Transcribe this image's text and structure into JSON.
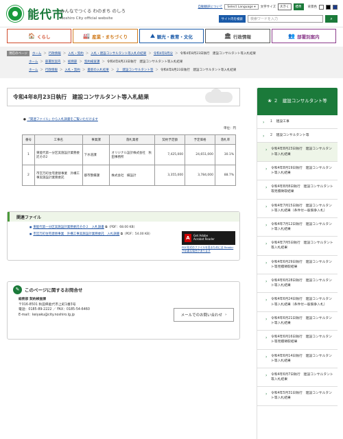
{
  "header": {
    "site_name": "能代市",
    "tagline": "みんなでつくる わのまち のしろ",
    "subtitle": "Noshiro City official website",
    "auto_translate": "自動翻訳について",
    "language_select": "Select Language",
    "text_size_label": "文字サイズ",
    "enlarge": "大きく",
    "standard": "標準",
    "bg_color_label": "背景色",
    "search_button": "サイト内を検索",
    "search_placeholder": "検索ワードを入力"
  },
  "nav": [
    {
      "label": "くらし",
      "icon": "🏠",
      "color": "#d04a2a"
    },
    {
      "label": "産業・まちづくり",
      "icon": "🏭",
      "color": "#d07a1a"
    },
    {
      "label": "観光・教育・文化",
      "icon": "⛰",
      "color": "#1a5aa8"
    },
    {
      "label": "行政情報",
      "icon": "🏛",
      "color": "#555555"
    },
    {
      "label": "部署別案内",
      "icon": "👥",
      "color": "#8a3a8a"
    }
  ],
  "breadcrumbs": {
    "current_label": "現在のページ",
    "rows": [
      [
        "ホーム",
        "行政情報",
        "入札・契約",
        "入札・建設コンサルタント等入札の結果",
        "令和4年8月分",
        "令和4年8月23日執行　建設コンサルタント等入札結果"
      ],
      [
        "ホーム",
        "部署別案内",
        "総務部",
        "契約検査課",
        "令和4年8月23日執行　建設コンサルタント等入札結果"
      ],
      [
        "ホーム",
        "行政情報",
        "入札・契約",
        "最新の入札結果",
        "２　建設コンサルタント等",
        "令和4年8月23日執行　建設コンサルタント等入札結果"
      ]
    ]
  },
  "page": {
    "title": "令和4年8月23日執行　建設コンサルタント等入札結果",
    "intro": "「関連ファイル」から入札調書をご覧いただけます",
    "unit": "単位：円"
  },
  "table": {
    "headers": [
      "番号",
      "工事名",
      "事業課",
      "落札業者",
      "契約予定額",
      "予定価格",
      "落札率"
    ],
    "rows": [
      [
        "1",
        "東能代第一分区実施設計業務委託その2",
        "下水道課",
        "オリジナル設計株式会社　秋田事務所",
        "7,425,000",
        "24,651,000",
        "30.1%"
      ],
      [
        "2",
        "市営万町住宅建替事業　外構工事実施設計業務委託",
        "都市整備課",
        "株式会社　縁設計",
        "3,355,000",
        "3,784,000",
        "88.7%"
      ]
    ]
  },
  "related": {
    "title": "関連ファイル",
    "files": [
      {
        "name": "東能代第一分区実施設計業務委託その２　入札調書",
        "meta": "（PDF：68.00 KB）"
      },
      {
        "name": "市営万町住宅建替事業　外構工事実施設計業務委託　入札調書",
        "meta": "（PDF：54.00 KB）"
      }
    ],
    "adobe_get": "Get Adobe",
    "adobe_reader": "Acrobat Reader",
    "adobe_note": "PDF形式のファイルを見るためには Reader が必要な場合があります"
  },
  "contact": {
    "title": "このページに関するお問合せ",
    "dept": "総務部 契約検査課",
    "address": "〒016-8501 秋田県能代市上町1番3号",
    "phone": "電話：0185-89-2222 ／ FAX：0185-54-6460",
    "email": "E-mail：keiyaku@city.noshiro.lg.jp",
    "mail_button": "メールでのお問い合わせ"
  },
  "sidebar": {
    "title": "２　建設コンサルタント等",
    "items": [
      {
        "label": "１　建設工事",
        "level": "top"
      },
      {
        "label": "２　建設コンサルタント等",
        "level": "top"
      },
      {
        "label": "令和4年8月23日執行　建設コンサルタント等入札結果",
        "level": "sub",
        "active": true
      },
      {
        "label": "令和4年8月19日執行　建設コンサルタント等入札結果",
        "level": "sub"
      },
      {
        "label": "令和4年8月8日執行　建設コンサルタント等見積徴取結果",
        "level": "sub"
      },
      {
        "label": "令和4年7月15日執行　建設コンサルタント等入札結果（条件付一般競争入札）",
        "level": "sub"
      },
      {
        "label": "令和4年7月12日執行　建設コンサルタント等入札結果",
        "level": "sub"
      },
      {
        "label": "令和4年7月5日執行　建設コンサルタント等入札結果",
        "level": "sub"
      },
      {
        "label": "令和4年6月29日執行　建設コンサルタント等見積徴取結果",
        "level": "sub"
      },
      {
        "label": "令和4年6月28日執行　建設コンサルタント等入札結果",
        "level": "sub"
      },
      {
        "label": "令和4年6月24日執行　建設コンサルタント等入札結果（条件付一般競争入札）",
        "level": "sub"
      },
      {
        "label": "令和4年6月21日執行　建設コンサルタント等入札結果",
        "level": "sub"
      },
      {
        "label": "令和4年6月16日執行　建設コンサルタント等見積徴取結果",
        "level": "sub"
      },
      {
        "label": "令和4年6月14日執行　建設コンサルタント等入札結果",
        "level": "sub"
      },
      {
        "label": "令和4年6月7日執行　建設コンサルタント等入札結果",
        "level": "sub"
      },
      {
        "label": "令和4年5月31日執行　建設コンサルタント等入札結果",
        "level": "sub"
      }
    ]
  }
}
